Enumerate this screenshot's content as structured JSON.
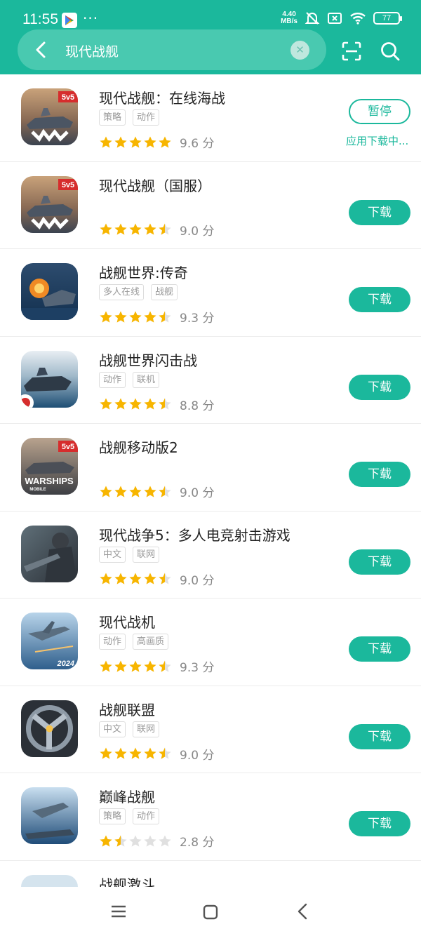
{
  "status_bar": {
    "time": "11:55",
    "dots": "···",
    "net_speed_value": "4.40",
    "net_speed_unit": "MB/s",
    "battery": "77"
  },
  "search": {
    "query": "现代战舰"
  },
  "download_label": "下载",
  "apps": [
    {
      "title": "现代战舰：在线海战",
      "tags": [
        "策略",
        "动作"
      ],
      "rating": 5.0,
      "score": "9.6 分",
      "button": "暂停",
      "status": "应用下载中...",
      "icon_theme": "battleship-mw"
    },
    {
      "title": "现代战舰（国服）",
      "tags": [],
      "rating": 4.5,
      "score": "9.0 分",
      "button": "下载",
      "status": "",
      "icon_theme": "battleship-mw"
    },
    {
      "title": "战舰世界:传奇",
      "tags": [
        "多人在线",
        "战舰"
      ],
      "rating": 4.5,
      "score": "9.3 分",
      "button": "下载",
      "status": "",
      "icon_theme": "battle-fire"
    },
    {
      "title": "战舰世界闪击战",
      "tags": [
        "动作",
        "联机"
      ],
      "rating": 4.5,
      "score": "8.8 分",
      "button": "下载",
      "status": "",
      "icon_theme": "ocean-fleet"
    },
    {
      "title": "战舰移动版2",
      "tags": [],
      "rating": 4.5,
      "score": "9.0 分",
      "button": "下载",
      "status": "",
      "icon_theme": "warships-mobile"
    },
    {
      "title": "现代战争5：多人电竞射击游戏",
      "tags": [
        "中文",
        "联网"
      ],
      "rating": 4.5,
      "score": "9.0 分",
      "button": "下载",
      "status": "",
      "icon_theme": "soldier"
    },
    {
      "title": "现代战机",
      "tags": [
        "动作",
        "高画质"
      ],
      "rating": 4.5,
      "score": "9.3 分",
      "button": "下载",
      "status": "",
      "icon_theme": "fighter-jet"
    },
    {
      "title": "战舰联盟",
      "tags": [
        "中文",
        "联网"
      ],
      "rating": 4.5,
      "score": "9.0 分",
      "button": "下载",
      "status": "",
      "icon_theme": "emblem"
    },
    {
      "title": "巅峰战舰",
      "tags": [
        "策略",
        "动作"
      ],
      "rating": 1.5,
      "score": "2.8 分",
      "button": "下载",
      "status": "",
      "icon_theme": "jet-carrier"
    },
    {
      "title": "战舰激斗",
      "tags": [],
      "rating": 0,
      "score": "",
      "button": "",
      "status": "",
      "icon_theme": "partial"
    }
  ],
  "icon_text": {
    "mode_badge": "5v5",
    "warships_word": "WARSHIPS",
    "warships_sub": "MOBILE",
    "year": "2024"
  },
  "colors": {
    "accent": "#1bb89c",
    "star": "#f7b500",
    "star_empty": "#e0e0e0"
  }
}
